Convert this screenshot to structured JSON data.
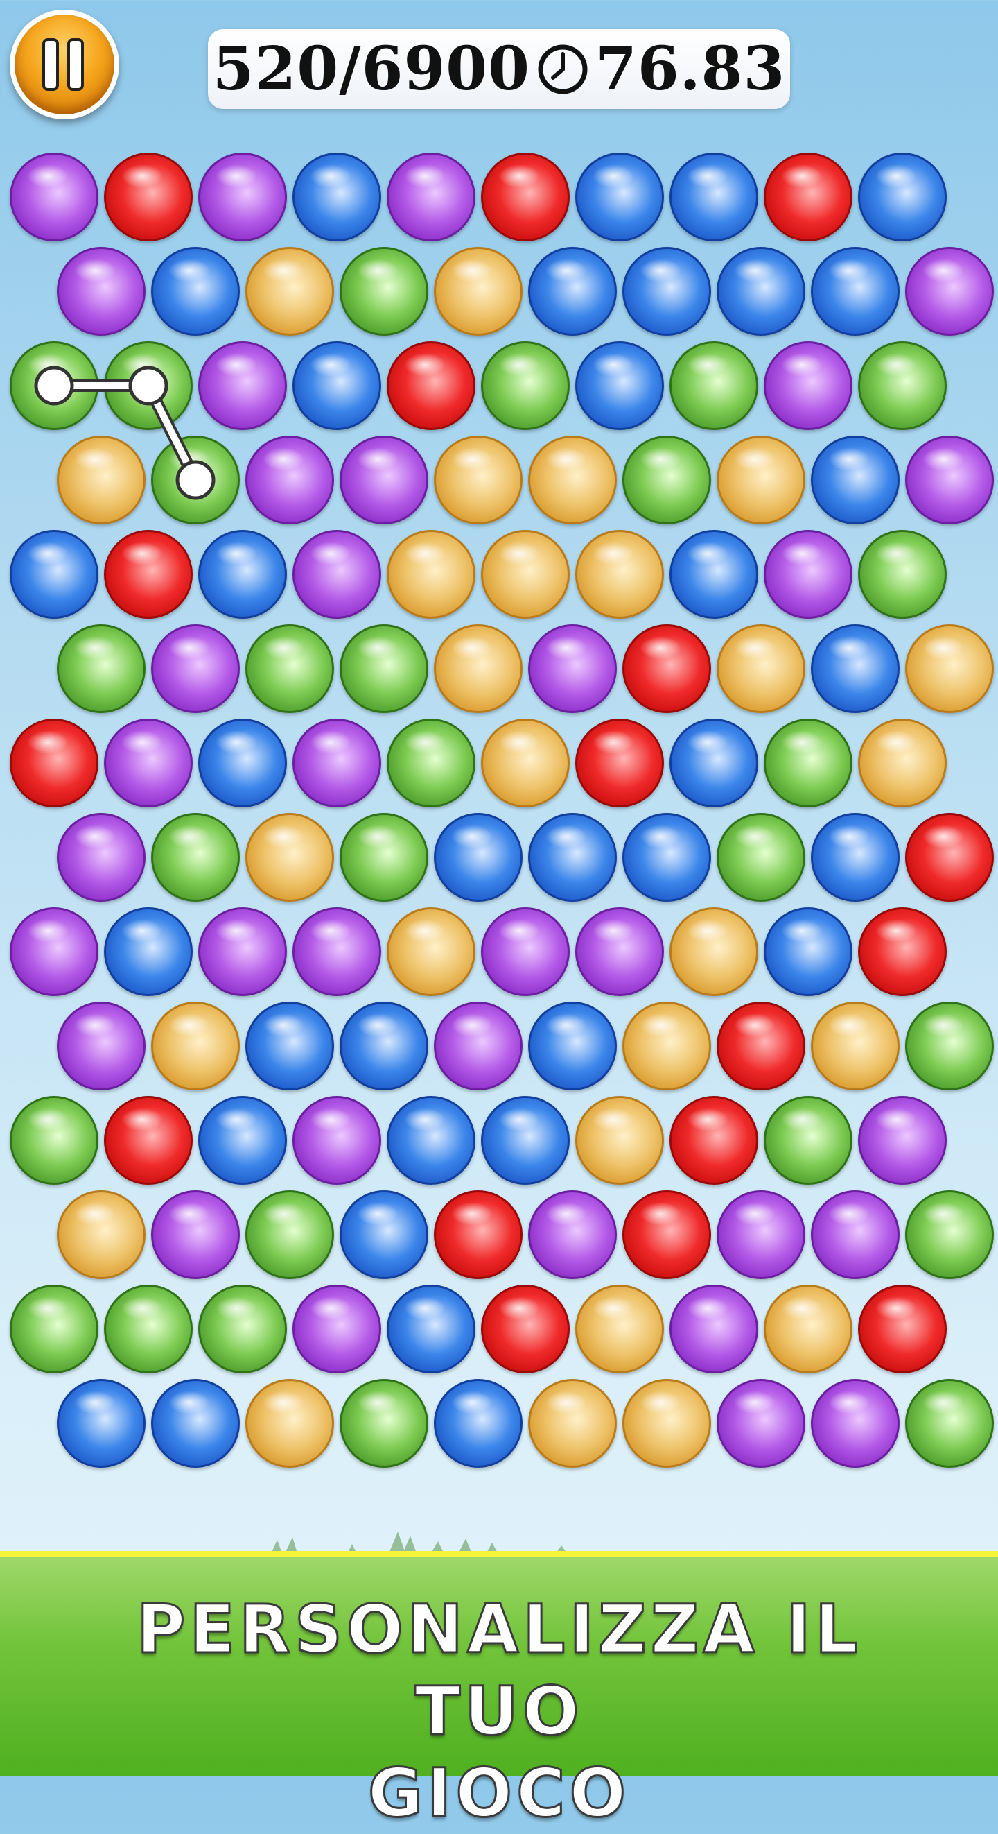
{
  "hud": {
    "score": "520/6900",
    "timer": "76.83"
  },
  "colors": {
    "purple": "#b45be8",
    "red": "#f02a2a",
    "blue": "#3c86ea",
    "gold": "#eec36a",
    "green": "#7dcb52",
    "footer_green": "#5bb82a",
    "pause_orange": "#f5a51c"
  },
  "board": {
    "rows": [
      [
        "purple",
        "red",
        "purple",
        "blue",
        "purple",
        "red",
        "blue",
        "blue",
        "red",
        "blue"
      ],
      [
        "purple",
        "blue",
        "gold",
        "green",
        "gold",
        "blue",
        "blue",
        "blue",
        "blue",
        "purple"
      ],
      [
        "green",
        "green",
        "purple",
        "blue",
        "red",
        "green",
        "blue",
        "green",
        "purple",
        "green"
      ],
      [
        "gold",
        "green",
        "purple",
        "purple",
        "gold",
        "gold",
        "green",
        "gold",
        "blue",
        "purple"
      ],
      [
        "blue",
        "red",
        "blue",
        "purple",
        "gold",
        "gold",
        "gold",
        "blue",
        "purple",
        "green"
      ],
      [
        "green",
        "purple",
        "green",
        "green",
        "gold",
        "purple",
        "red",
        "gold",
        "blue",
        "gold"
      ],
      [
        "red",
        "purple",
        "blue",
        "purple",
        "green",
        "gold",
        "red",
        "blue",
        "green",
        "gold"
      ],
      [
        "purple",
        "green",
        "gold",
        "green",
        "blue",
        "blue",
        "blue",
        "green",
        "blue",
        "red"
      ],
      [
        "purple",
        "blue",
        "purple",
        "purple",
        "gold",
        "purple",
        "purple",
        "gold",
        "blue",
        "red"
      ],
      [
        "purple",
        "gold",
        "blue",
        "blue",
        "purple",
        "blue",
        "gold",
        "red",
        "gold",
        "green"
      ],
      [
        "green",
        "red",
        "blue",
        "purple",
        "blue",
        "blue",
        "gold",
        "red",
        "green",
        "purple"
      ],
      [
        "gold",
        "purple",
        "green",
        "blue",
        "red",
        "purple",
        "red",
        "purple",
        "purple",
        "green"
      ],
      [
        "green",
        "green",
        "green",
        "purple",
        "blue",
        "red",
        "gold",
        "purple",
        "gold",
        "red"
      ],
      [
        "blue",
        "blue",
        "gold",
        "green",
        "blue",
        "gold",
        "gold",
        "purple",
        "purple",
        "green"
      ]
    ],
    "selected_chain": [
      [
        2,
        0
      ],
      [
        2,
        1
      ],
      [
        3,
        1
      ]
    ]
  },
  "footer": {
    "title_line1": "PERSONALIZZA IL TUO",
    "title_line2": "GIOCO"
  },
  "icons": {
    "pause": "pause-icon",
    "clock": "clock-icon"
  }
}
